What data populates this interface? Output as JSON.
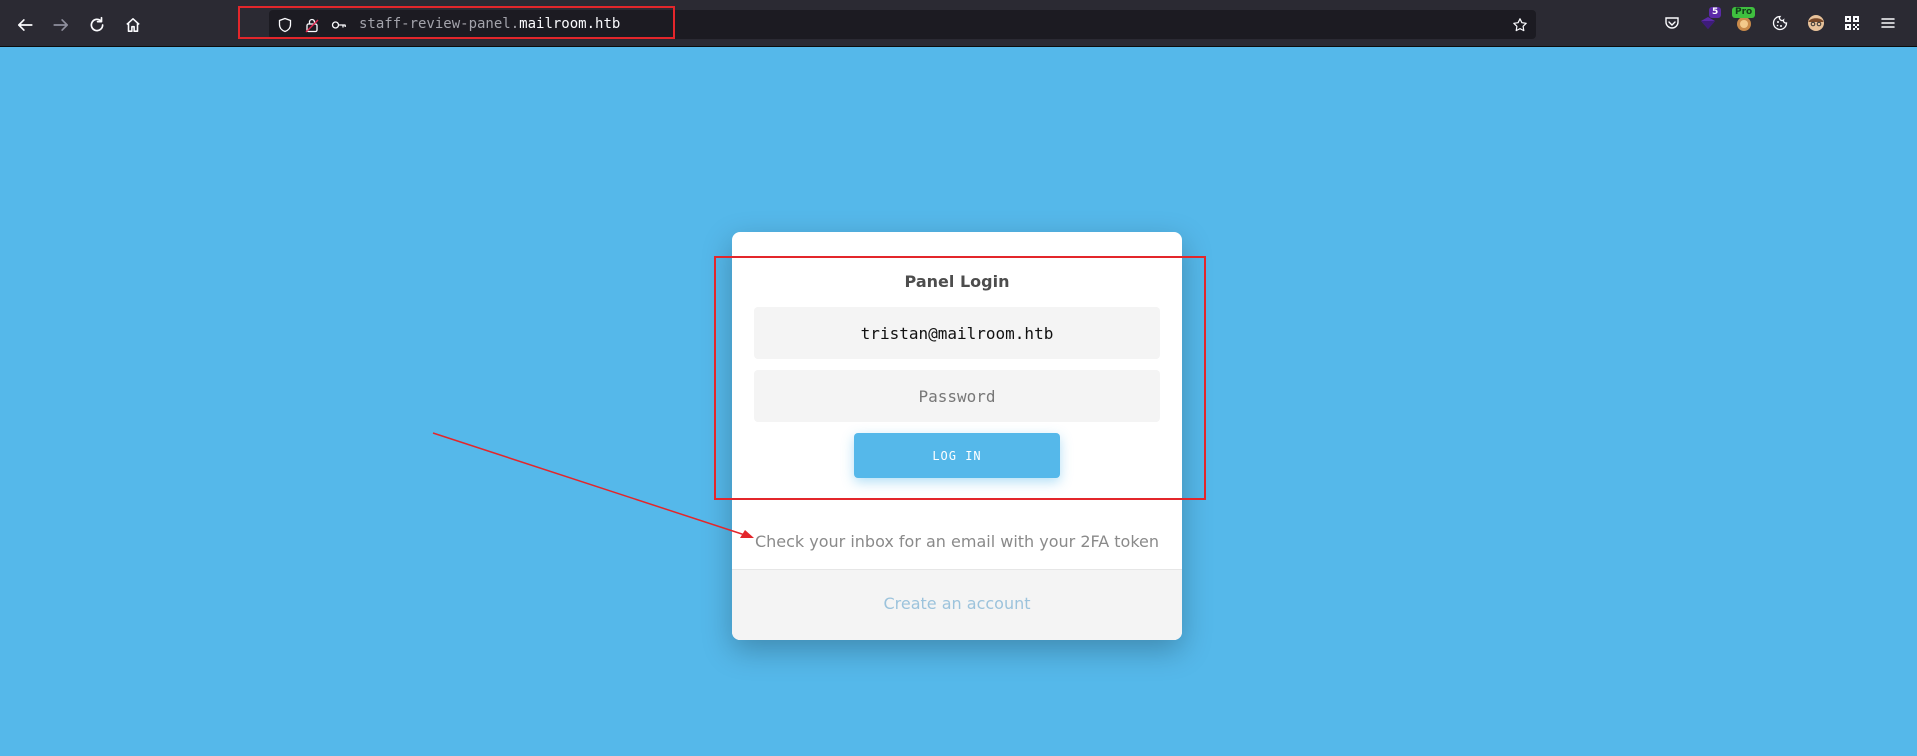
{
  "browser": {
    "url_subdomain": "staff-review-panel.",
    "url_domain": "mailroom.htb",
    "extensions": [
      {
        "name": "pocket-icon"
      },
      {
        "name": "extension-badge-icon",
        "badge": "5"
      },
      {
        "name": "wappalyzer-icon",
        "badge": "Pro"
      },
      {
        "name": "cookie-icon"
      },
      {
        "name": "avatar-icon"
      },
      {
        "name": "qr-icon"
      }
    ]
  },
  "login": {
    "title": "Panel Login",
    "email_value": "tristan@mailroom.htb",
    "password_placeholder": "Password",
    "login_label": "LOG IN",
    "message": "Check your inbox for an email with your 2FA token",
    "create_account_label": "Create an account"
  },
  "colors": {
    "page_background": "#55b8ea",
    "annotation_red": "#e3262b",
    "toolbar": "#2b2a33"
  }
}
